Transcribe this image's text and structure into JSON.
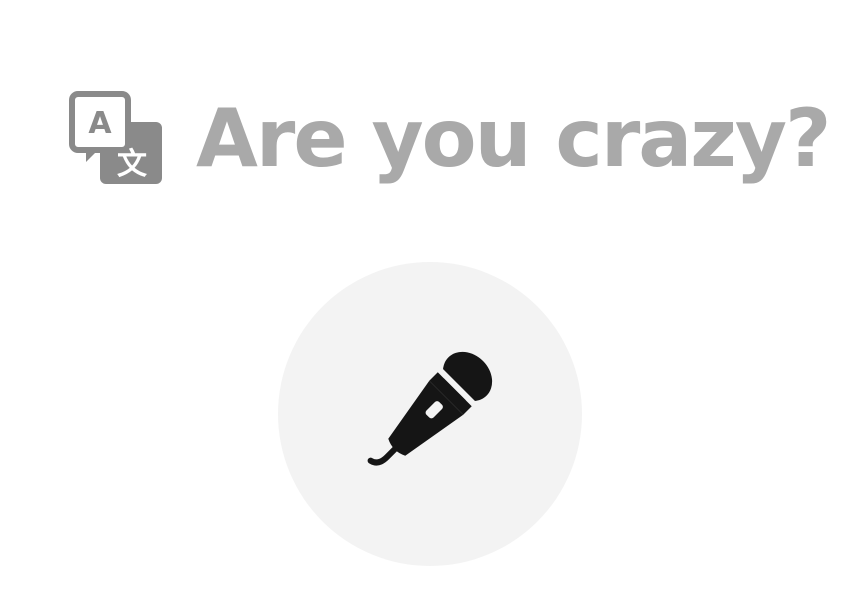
{
  "prompt": {
    "text": "Are you crazy?",
    "translate_icon": "translate-icon",
    "text_color": "#a9a9a9"
  },
  "mic_button": {
    "icon": "microphone-icon",
    "background": "#f3f3f3"
  },
  "translate_glyph": {
    "source": "A",
    "target": "文"
  }
}
